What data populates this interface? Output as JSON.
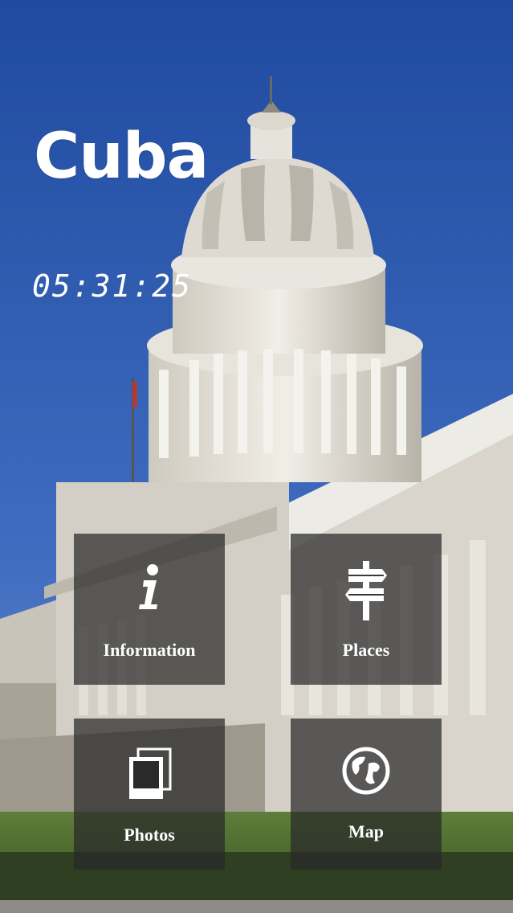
{
  "title": "Cuba",
  "clock": "05:31:25",
  "tiles": {
    "information": {
      "label": "Information",
      "icon": "info-icon"
    },
    "places": {
      "label": "Places",
      "icon": "signpost-icon"
    },
    "photos": {
      "label": "Photos",
      "icon": "photos-icon"
    },
    "map": {
      "label": "Map",
      "icon": "globe-icon"
    }
  }
}
